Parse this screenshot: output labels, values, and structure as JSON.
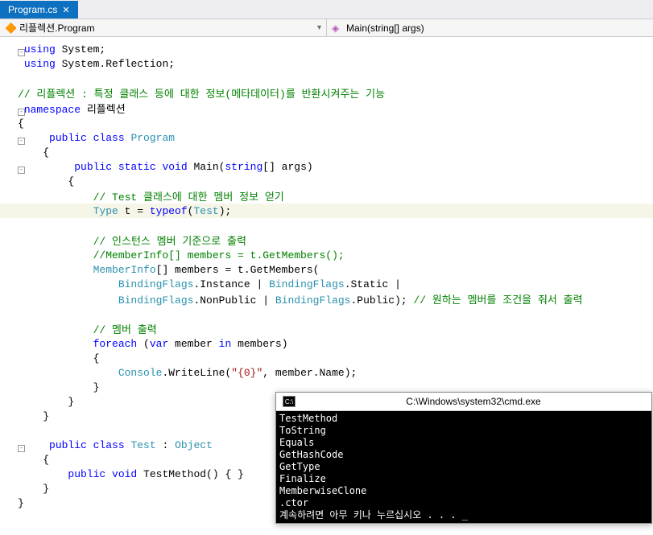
{
  "tab": {
    "filename": "Program.cs",
    "close": "✕"
  },
  "nav": {
    "class_icon": "⬛",
    "class_text": "리플렉션.Program",
    "method_icon": "◈",
    "method_text": "Main(string[] args)",
    "dropdown": "▾"
  },
  "code": {
    "l1": "using",
    "l1b": " System;",
    "l2": "using",
    "l2b": " System.Reflection;",
    "l4": "// 리플렉션 : 특정 클래스 등에 대한 정보(메타데이터)를 반환시켜주는 기능",
    "l5a": "namespace",
    "l5b": " 리플렉션",
    "l6": "{",
    "l7a": "    public",
    "l7b": " class",
    "l7c": " Program",
    "l8": "    {",
    "l9a": "        public",
    "l9b": " static",
    "l9c": " void",
    "l9d": " Main(",
    "l9e": "string",
    "l9f": "[] args)",
    "l10": "        {",
    "l11": "            // Test 클래스에 대한 멤버 정보 얻기",
    "l12a": "            Type",
    "l12b": " t = ",
    "l12c": "typeof",
    "l12d": "(",
    "l12e": "Test",
    "l12f": ");",
    "l14": "            // 인스턴스 멤버 기준으로 출력",
    "l15": "            //MemberInfo[] members = t.GetMembers();",
    "l16a": "            MemberInfo",
    "l16b": "[] members = t.GetMembers(",
    "l17a": "                BindingFlags",
    "l17b": ".Instance | ",
    "l17c": "BindingFlags",
    "l17d": ".Static |",
    "l18a": "                BindingFlags",
    "l18b": ".NonPublic | ",
    "l18c": "BindingFlags",
    "l18d": ".Public); ",
    "l18e": "// 원하는 멤버를 조건을 줘서 출력",
    "l20": "            // 멤버 출력",
    "l21a": "            foreach",
    "l21b": " (",
    "l21c": "var",
    "l21d": " member ",
    "l21e": "in",
    "l21f": " members)",
    "l22": "            {",
    "l23a": "                Console",
    "l23b": ".WriteLine(",
    "l23c": "\"{0}\"",
    "l23d": ", member.Name);",
    "l24": "            }",
    "l25": "        }",
    "l26": "    }",
    "l28a": "    public",
    "l28b": " class",
    "l28c": " Test",
    "l28d": " : ",
    "l28e": "Object",
    "l29": "    {",
    "l30a": "        public",
    "l30b": " void",
    "l30c": " TestMethod() { }",
    "l31": "    }",
    "l32": "}"
  },
  "console": {
    "title_icon": "C:\\",
    "title": "C:\\Windows\\system32\\cmd.exe",
    "output": "TestMethod\nToString\nEquals\nGetHashCode\nGetType\nFinalize\nMemberwiseClone\n.ctor\n계속하려면 아무 키나 누르십시오 . . . _"
  }
}
